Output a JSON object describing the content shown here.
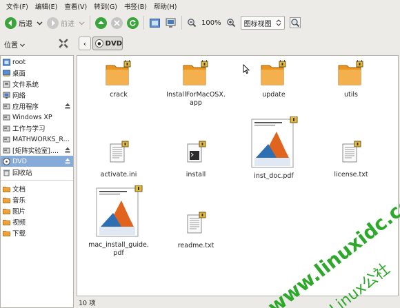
{
  "menu": [
    "文件(F)",
    "编辑(E)",
    "查看(V)",
    "转到(G)",
    "书签(B)",
    "帮助(H)"
  ],
  "toolbar": {
    "back_label": "后退",
    "forward_label": "前进",
    "zoom_value": "100%",
    "view_mode": "图标视图"
  },
  "location": {
    "label": "位置",
    "crumb": "DVD"
  },
  "sidebar": {
    "items": [
      {
        "label": "root",
        "icon": "home-icon"
      },
      {
        "label": "桌面",
        "icon": "desktop-icon"
      },
      {
        "label": "文件系统",
        "icon": "drive-icon"
      },
      {
        "label": "网络",
        "icon": "network-icon"
      },
      {
        "label": "应用程序",
        "icon": "drive-icon"
      },
      {
        "label": "Windows XP",
        "icon": "drive-icon"
      },
      {
        "label": "工作与学习",
        "icon": "drive-icon"
      },
      {
        "label": "MATHWORKS_R...",
        "icon": "drive-icon"
      },
      {
        "label": "[矩阵实验室]....",
        "icon": "drive-icon"
      },
      {
        "label": "DVD",
        "icon": "dvd-icon"
      },
      {
        "label": "回收站",
        "icon": "trash-icon"
      }
    ],
    "bookmarks": [
      {
        "label": "文档",
        "icon": "folder-icon"
      },
      {
        "label": "音乐",
        "icon": "folder-icon"
      },
      {
        "label": "图片",
        "icon": "folder-icon"
      },
      {
        "label": "视频",
        "icon": "folder-icon"
      },
      {
        "label": "下载",
        "icon": "folder-icon"
      }
    ]
  },
  "files": [
    {
      "name": "crack",
      "type": "folder"
    },
    {
      "name": "InstallForMacOSX.\napp",
      "type": "folder"
    },
    {
      "name": "update",
      "type": "folder"
    },
    {
      "name": "utils",
      "type": "folder"
    },
    {
      "name": "activate.ini",
      "type": "text"
    },
    {
      "name": "install",
      "type": "script"
    },
    {
      "name": "inst_doc.pdf",
      "type": "pdf"
    },
    {
      "name": "license.txt",
      "type": "text"
    },
    {
      "name": "mac_install_guide.\npdf",
      "type": "pdf"
    },
    {
      "name": "readme.txt",
      "type": "text"
    }
  ],
  "status": "10 项",
  "watermark": {
    "url": "www.linuxidc.com",
    "brand": "Linux公社"
  },
  "colors": {
    "selection": "#86abd9",
    "folder": "#f0a23a",
    "watermark": "#2da82a"
  }
}
